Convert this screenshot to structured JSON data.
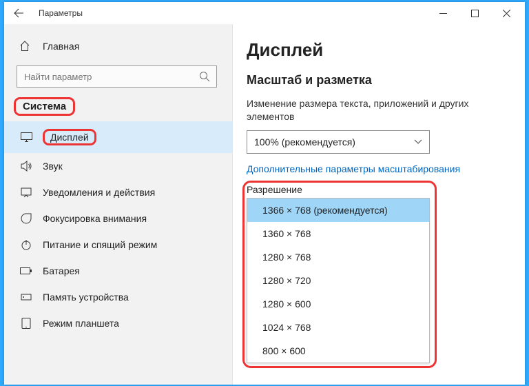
{
  "window": {
    "title": "Параметры"
  },
  "sidebar": {
    "home_label": "Главная",
    "search_placeholder": "Найти параметр",
    "group_title": "Система",
    "items": [
      {
        "label": "Дисплей"
      },
      {
        "label": "Звук"
      },
      {
        "label": "Уведомления и действия"
      },
      {
        "label": "Фокусировка внимания"
      },
      {
        "label": "Питание и спящий режим"
      },
      {
        "label": "Батарея"
      },
      {
        "label": "Память устройства"
      },
      {
        "label": "Режим планшета"
      }
    ]
  },
  "main": {
    "heading": "Дисплей",
    "scale_heading": "Масштаб и разметка",
    "scale_desc": "Изменение размера текста, приложений и других элементов",
    "scale_value": "100% (рекомендуется)",
    "advanced_link": "Дополнительные параметры масштабирования",
    "resolution_label": "Разрешение",
    "resolution_options": [
      "1366 × 768 (рекомендуется)",
      "1360 × 768",
      "1280 × 768",
      "1280 × 720",
      "1280 × 600",
      "1024 × 768",
      "800 × 600"
    ]
  }
}
